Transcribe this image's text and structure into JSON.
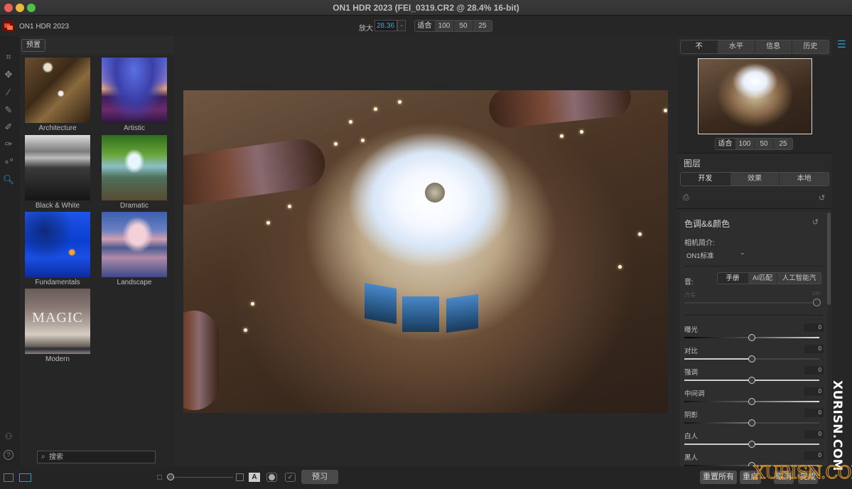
{
  "window": {
    "title": "ON1 HDR 2023 (FEI_0319.CR2 @ 28.4% 16-bit)"
  },
  "appbar": {
    "app_name": "ON1 HDR 2023",
    "zoom_label": "放大",
    "zoom_value": "28.36",
    "zoom_options": [
      "适合",
      "100",
      "50",
      "25"
    ],
    "zoom_active": "适合"
  },
  "tools": [
    {
      "name": "crop-tool",
      "icon": "crop-icon"
    },
    {
      "name": "transform-tool",
      "icon": "move-icon"
    },
    {
      "name": "magic-wand-tool",
      "icon": "magic-wand-icon"
    },
    {
      "name": "retouch-tool",
      "icon": "brush-icon"
    },
    {
      "name": "mask-brush-tool",
      "icon": "mask-brush-icon"
    },
    {
      "name": "masking-bug-tool",
      "icon": "mask-brush-alt-icon"
    },
    {
      "name": "deghost-tool",
      "icon": "circles-icon"
    },
    {
      "name": "zoom-hand-tool",
      "icon": "zoom-hand-icon",
      "active": true
    }
  ],
  "presets": {
    "header_button": "预置",
    "categories": [
      {
        "label": "Architecture"
      },
      {
        "label": "Artistic"
      },
      {
        "label": "Black & White"
      },
      {
        "label": "Dramatic"
      },
      {
        "label": "Fundamentals"
      },
      {
        "label": "Landscape"
      },
      {
        "label": "Modern",
        "thumb_text": "MAGIC"
      }
    ],
    "search_placeholder": "搜索"
  },
  "bottombar": {
    "preview_label": "预习",
    "reset_all_label": "重置所有",
    "reset_label": "重启",
    "cancel_label": "取消",
    "done_label": "完成"
  },
  "right_panel": {
    "tabs": [
      "不",
      "水平",
      "信息",
      "历史"
    ],
    "tab_active": "不",
    "navigator_zoom": [
      "适合",
      "100",
      "50",
      "25"
    ],
    "navigator_zoom_active": "适合",
    "layers_title": "图层",
    "layer_tabs": [
      "开发",
      "效果",
      "本地"
    ],
    "layer_tab_active": "开发",
    "tone_color": {
      "title": "色调&&颜色",
      "camera_profile_label": "相机简介:",
      "camera_profile_value": "ON1标准",
      "tone_label": "音:",
      "tone_modes": [
        "手册",
        "AI匹配",
        "人工智能汽车"
      ],
      "tone_mode_active": "手册",
      "auto_label": "汽车",
      "auto_value": "100",
      "sliders": [
        {
          "label": "曝光",
          "value": "0"
        },
        {
          "label": "对比",
          "value": "0"
        },
        {
          "label": "强调",
          "value": "0"
        },
        {
          "label": "中间调",
          "value": "0"
        },
        {
          "label": "阴影",
          "value": "0"
        },
        {
          "label": "白人",
          "value": "0"
        },
        {
          "label": "黑人",
          "value": "0"
        }
      ]
    }
  },
  "watermarks": {
    "vertical": "XURISN.COM",
    "horizontal": "XURISN.COM"
  },
  "colors": {
    "accent": "#2d9bd0",
    "background": "#232323",
    "panel": "#2a2a2a"
  }
}
